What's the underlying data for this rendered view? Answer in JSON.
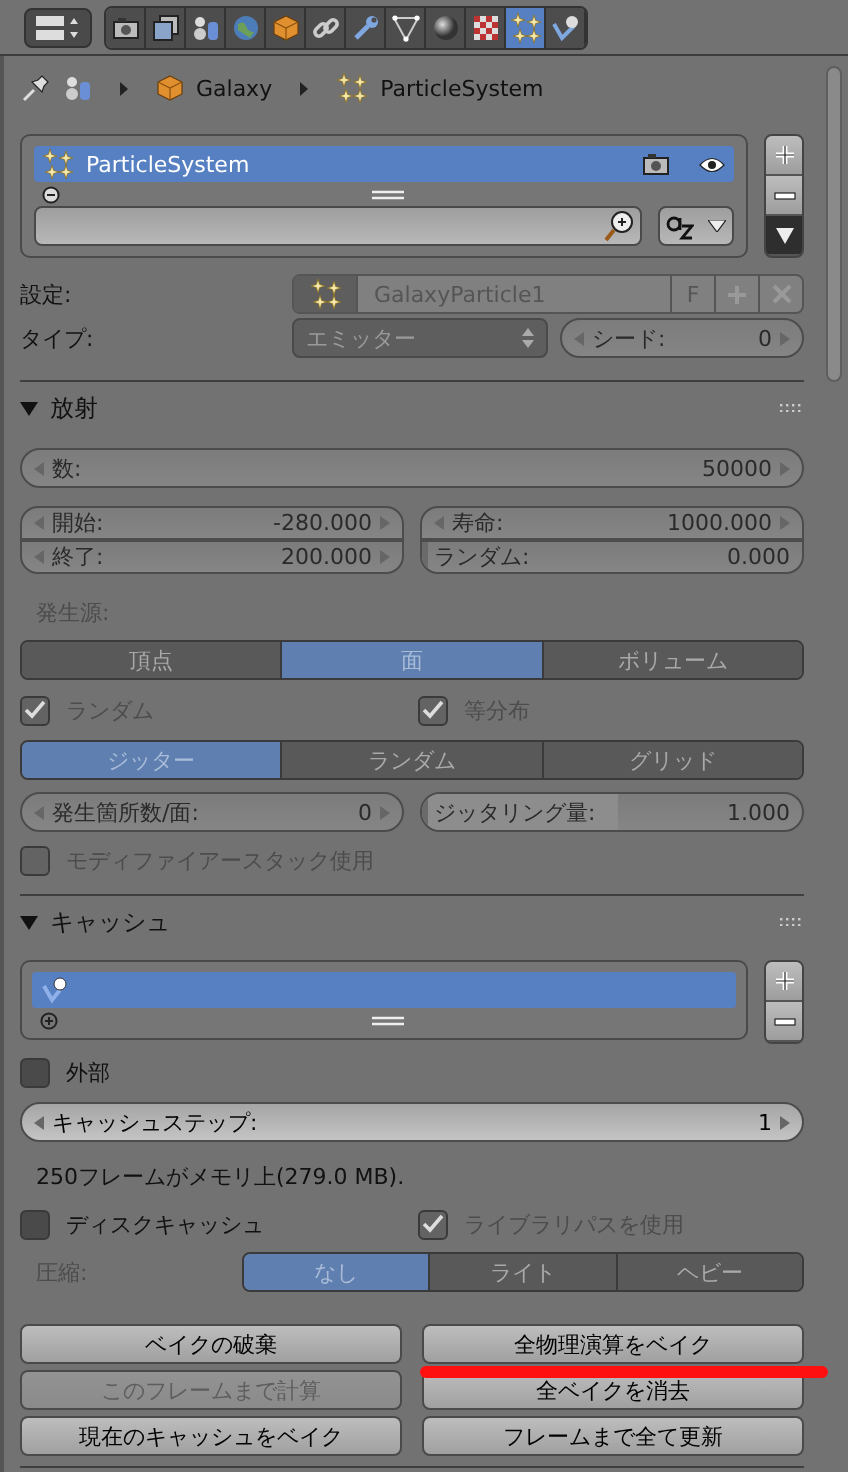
{
  "header": {
    "tabs": [
      {
        "kind": "render",
        "selected": false
      },
      {
        "kind": "layers",
        "selected": false
      },
      {
        "kind": "scene",
        "selected": false
      },
      {
        "kind": "world",
        "selected": false
      },
      {
        "kind": "object",
        "selected": false
      },
      {
        "kind": "constraints",
        "selected": false
      },
      {
        "kind": "modifiers",
        "selected": false
      },
      {
        "kind": "data",
        "selected": false
      },
      {
        "kind": "material",
        "selected": false
      },
      {
        "kind": "texture",
        "selected": false
      },
      {
        "kind": "particles",
        "selected": true
      },
      {
        "kind": "physics",
        "selected": false
      }
    ]
  },
  "breadcrumb": [
    {
      "kind": "object",
      "label": "Galaxy"
    },
    {
      "kind": "particles",
      "label": "ParticleSystem"
    }
  ],
  "particle_systems": {
    "items": [
      {
        "name": "ParticleSystem",
        "selected": true
      }
    ]
  },
  "settings": {
    "label": "設定:",
    "value": "GalaxyParticle1",
    "fake_user": "F",
    "disabled": true
  },
  "type": {
    "label": "タイプ:",
    "value": "エミッター",
    "seed_label": "シード:",
    "seed_value": "0",
    "disabled": true
  },
  "emission": {
    "title": "放射",
    "expanded": true,
    "disabled": true,
    "number": {
      "label": "数:",
      "value": "50000"
    },
    "frames": [
      {
        "label": "開始:",
        "value": "-280.000"
      },
      {
        "label": "終了:",
        "value": "200.000"
      }
    ],
    "lifetime": {
      "label": "寿命:",
      "value": "1000.000"
    },
    "lifetime_random": {
      "label": "ランダム:",
      "value": "0.000",
      "level": 0
    },
    "emit_from_label": "発生源:",
    "emit_from": [
      {
        "label": "頂点",
        "selected": false
      },
      {
        "label": "面",
        "selected": true
      },
      {
        "label": "ボリューム",
        "selected": false
      }
    ],
    "options": [
      {
        "label": "ランダム",
        "checked": true
      },
      {
        "label": "等分布",
        "checked": true
      }
    ],
    "distribution": [
      {
        "label": "ジッター",
        "selected": true
      },
      {
        "label": "ランダム",
        "selected": false
      },
      {
        "label": "グリッド",
        "selected": false
      }
    ],
    "per_face": {
      "label": "発生箇所数/面:",
      "value": "0"
    },
    "jitter": {
      "label": "ジッタリング量:",
      "value": "1.000",
      "level": 0.5
    },
    "use_modifier_stack": {
      "label": "モディファイアースタック使用",
      "checked": false
    }
  },
  "cache": {
    "title": "キャッシュ",
    "expanded": true,
    "items": [
      {
        "selected": true
      }
    ],
    "external": {
      "label": "外部",
      "checked": false
    },
    "step": {
      "label": "キャッシュステップ:",
      "value": "1"
    },
    "info": "250フレームがメモリ上(279.0 MB).",
    "disk_cache": {
      "label": "ディスクキャッシュ",
      "checked": false
    },
    "library_path": {
      "label": "ライブラリパスを使用",
      "checked": true,
      "disabled": true
    },
    "compression_label": "圧縮:",
    "compression_disabled": true,
    "compression": [
      {
        "label": "なし",
        "selected": true
      },
      {
        "label": "ライト",
        "selected": false
      },
      {
        "label": "ヘビー",
        "selected": false
      }
    ]
  },
  "bake_buttons": [
    {
      "label": "ベイクの破棄",
      "disabled": false
    },
    {
      "label": "全物理演算をベイク",
      "disabled": false
    },
    {
      "label": "このフレームまで計算",
      "disabled": true
    },
    {
      "label": "全ベイクを消去",
      "disabled": false
    },
    {
      "label": "現在のキャッシュをベイク",
      "disabled": false
    },
    {
      "label": "フレームまで全て更新",
      "disabled": false
    }
  ]
}
